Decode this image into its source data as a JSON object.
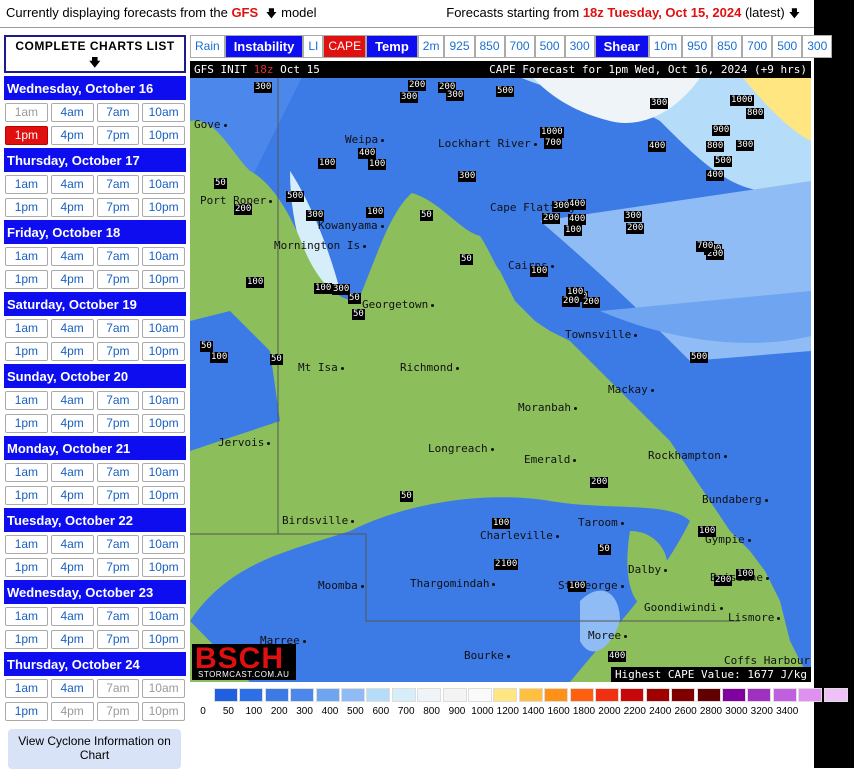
{
  "topbar": {
    "left_prefix": "Currently displaying forecasts from the",
    "model": "GFS",
    "left_suffix": "model",
    "right_prefix": "Forecasts starting from",
    "run": "18z Tuesday, Oct 15, 2024",
    "right_suffix": "(latest)"
  },
  "sidebar": {
    "complete_label": "COMPLETE CHARTS LIST",
    "days": [
      {
        "label": "Wednesday, October 16",
        "slots": [
          "1am",
          "4am",
          "7am",
          "10am",
          "1pm",
          "4pm",
          "7pm",
          "10pm"
        ]
      },
      {
        "label": "Thursday, October 17",
        "slots": [
          "1am",
          "4am",
          "7am",
          "10am",
          "1pm",
          "4pm",
          "7pm",
          "10pm"
        ]
      },
      {
        "label": "Friday, October 18",
        "slots": [
          "1am",
          "4am",
          "7am",
          "10am",
          "1pm",
          "4pm",
          "7pm",
          "10pm"
        ]
      },
      {
        "label": "Saturday, October 19",
        "slots": [
          "1am",
          "4am",
          "7am",
          "10am",
          "1pm",
          "4pm",
          "7pm",
          "10pm"
        ]
      },
      {
        "label": "Sunday, October 20",
        "slots": [
          "1am",
          "4am",
          "7am",
          "10am",
          "1pm",
          "4pm",
          "7pm",
          "10pm"
        ]
      },
      {
        "label": "Monday, October 21",
        "slots": [
          "1am",
          "4am",
          "7am",
          "10am",
          "1pm",
          "4pm",
          "7pm",
          "10pm"
        ]
      },
      {
        "label": "Tuesday, October 22",
        "slots": [
          "1am",
          "4am",
          "7am",
          "10am",
          "1pm",
          "4pm",
          "7pm",
          "10pm"
        ]
      },
      {
        "label": "Wednesday, October 23",
        "slots": [
          "1am",
          "4am",
          "7am",
          "10am",
          "1pm",
          "4pm",
          "7pm",
          "10pm"
        ]
      },
      {
        "label": "Thursday, October 24",
        "slots": [
          "1am",
          "4am",
          "7am",
          "10am",
          "1pm",
          "4pm",
          "7pm",
          "10pm"
        ]
      }
    ],
    "selected": "Wednesday, October 16 1pm",
    "cyclone_label": "View Cyclone Information on Chart"
  },
  "params": [
    {
      "label": "Rain",
      "style": "plain"
    },
    {
      "label": "Instability",
      "style": "blue"
    },
    {
      "label": "LI",
      "style": "plain"
    },
    {
      "label": "CAPE",
      "style": "selected"
    },
    {
      "label": "Temp",
      "style": "blue"
    },
    {
      "label": "2m",
      "style": "plain"
    },
    {
      "label": "925",
      "style": "plain"
    },
    {
      "label": "850",
      "style": "plain"
    },
    {
      "label": "700",
      "style": "plain"
    },
    {
      "label": "500",
      "style": "plain"
    },
    {
      "label": "300",
      "style": "plain"
    },
    {
      "label": "Shear",
      "style": "blue"
    },
    {
      "label": "10m",
      "style": "plain"
    },
    {
      "label": "950",
      "style": "plain"
    },
    {
      "label": "850",
      "style": "plain"
    },
    {
      "label": "700",
      "style": "plain"
    },
    {
      "label": "500",
      "style": "plain"
    },
    {
      "label": "300",
      "style": "plain"
    }
  ],
  "map": {
    "header_init_prefix": "GFS INIT",
    "header_init_run": "18z",
    "header_init_date": "Oct 15",
    "header_right": "CAPE Forecast for 1pm Wed, Oct 16, 2024 (+9 hrs)",
    "logo_text": "BSCH",
    "logo_sub": "STORMCAST.COM.AU",
    "max_label": "Highest CAPE Value: 1677 J/kg",
    "places": [
      "Gove",
      "Weipa",
      "Lockhart River",
      "Port Roper",
      "Cape Flattery",
      "Kowanyama",
      "Mornington Is",
      "Cairns",
      "Georgetown",
      "Townsville",
      "Mt Isa",
      "Richmond",
      "Mackay",
      "Moranbah",
      "Jervois",
      "Longreach",
      "Emerald",
      "Rockhampton",
      "Bundaberg",
      "Birdsville",
      "Charleville",
      "Taroom",
      "Gympie",
      "Dalby",
      "Brisbane",
      "Moomba",
      "Thargomindah",
      "St George",
      "Goondiwindi",
      "Lismore",
      "Marree",
      "Bourke",
      "Moree",
      "Coffs Harbour"
    ],
    "contour_values": [
      "300",
      "200",
      "300",
      "200",
      "300",
      "500",
      "400",
      "300",
      "1000",
      "800",
      "900",
      "1000",
      "300",
      "700",
      "800",
      "500",
      "400",
      "100",
      "400",
      "500",
      "100",
      "300",
      "400",
      "200",
      "400",
      "300",
      "200",
      "300",
      "300",
      "200",
      "50",
      "100",
      "100",
      "100",
      "100",
      "200",
      "700",
      "300",
      "50",
      "50",
      "100",
      "50",
      "100",
      "50",
      "100",
      "50",
      "100",
      "100",
      "200",
      "200",
      "500",
      "50",
      "50",
      "100",
      "200",
      "100",
      "200",
      "50",
      "100",
      "400",
      "100",
      "200",
      "100"
    ]
  },
  "legend": {
    "colors": [
      "#1f5fe0",
      "#2e6fe8",
      "#3c7ae6",
      "#4c88ec",
      "#6ea4f0",
      "#8fbcf4",
      "#b5dcf8",
      "#d6eefa",
      "#eef4f8",
      "#f4f4f4",
      "#fafafa",
      "#ffe680",
      "#ffc040",
      "#ff9018",
      "#ff6010",
      "#f03010",
      "#c80808",
      "#a00000",
      "#800000",
      "#600000",
      "#8000a0",
      "#a030c0",
      "#c060e0",
      "#e090f0",
      "#f0c0f8"
    ],
    "labels": [
      "0",
      "50",
      "100",
      "200",
      "300",
      "400",
      "500",
      "600",
      "700",
      "800",
      "900",
      "1000",
      "1200",
      "1400",
      "1600",
      "1800",
      "2000",
      "2200",
      "2400",
      "2600",
      "2800",
      "3000",
      "3200",
      "3400"
    ]
  }
}
